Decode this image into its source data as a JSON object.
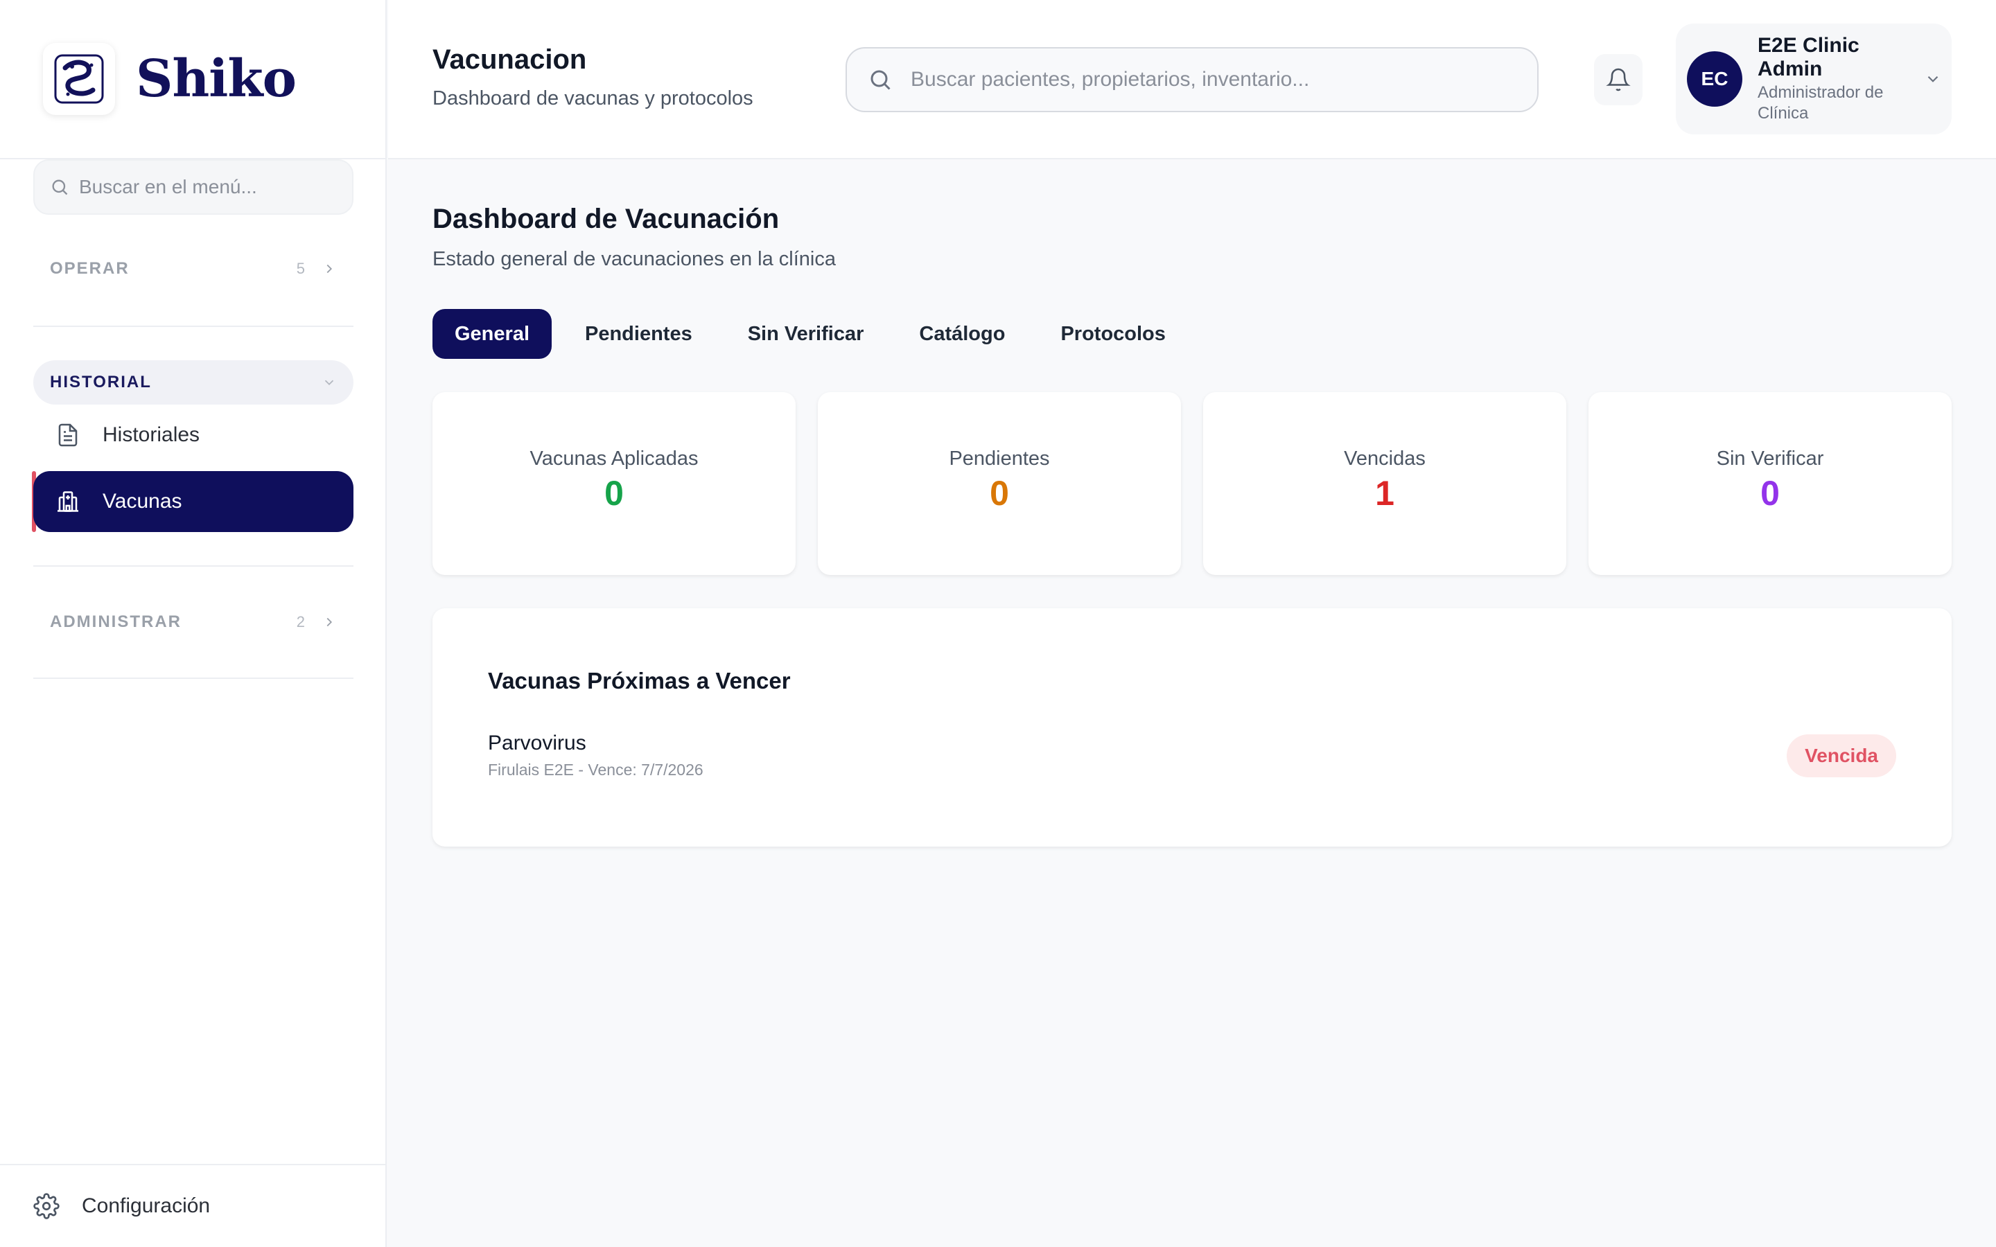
{
  "brand": {
    "name": "Shiko"
  },
  "sidebar": {
    "search_placeholder": "Buscar en el menú...",
    "sections": [
      {
        "label": "OPERAR",
        "count": "5",
        "expanded": false
      },
      {
        "label": "HISTORIAL",
        "expanded": true,
        "items": [
          {
            "label": "Historiales",
            "icon": "file-text-icon",
            "active": false
          },
          {
            "label": "Vacunas",
            "icon": "hospital-icon",
            "active": true
          }
        ]
      },
      {
        "label": "ADMINISTRAR",
        "count": "2",
        "expanded": false
      }
    ],
    "footer": {
      "label": "Configuración",
      "icon": "gear-icon"
    }
  },
  "header": {
    "title": "Vacunacion",
    "subtitle": "Dashboard de vacunas y protocolos",
    "search_placeholder": "Buscar pacientes, propietarios, inventario...",
    "user": {
      "initials": "EC",
      "name": "E2E Clinic Admin",
      "role": "Administrador de Clínica"
    }
  },
  "main": {
    "title": "Dashboard de Vacunación",
    "subtitle": "Estado general de vacunaciones en la clínica",
    "tabs": [
      {
        "label": "General",
        "active": true
      },
      {
        "label": "Pendientes",
        "active": false
      },
      {
        "label": "Sin Verificar",
        "active": false
      },
      {
        "label": "Catálogo",
        "active": false
      },
      {
        "label": "Protocolos",
        "active": false
      }
    ],
    "stats": [
      {
        "label": "Vacunas Aplicadas",
        "value": "0",
        "color": "#16a34a"
      },
      {
        "label": "Pendientes",
        "value": "0",
        "color": "#d97706"
      },
      {
        "label": "Vencidas",
        "value": "1",
        "color": "#dc2626"
      },
      {
        "label": "Sin Verificar",
        "value": "0",
        "color": "#9333ea"
      }
    ],
    "upcoming": {
      "title": "Vacunas Próximas a Vencer",
      "items": [
        {
          "name": "Parvovirus",
          "meta": "Firulais E2E - Vence: 7/7/2026",
          "status": "Vencida"
        }
      ]
    }
  },
  "colors": {
    "primary": "#0f0f5c",
    "accent": "#e05263",
    "background": "#f8f9fb"
  }
}
